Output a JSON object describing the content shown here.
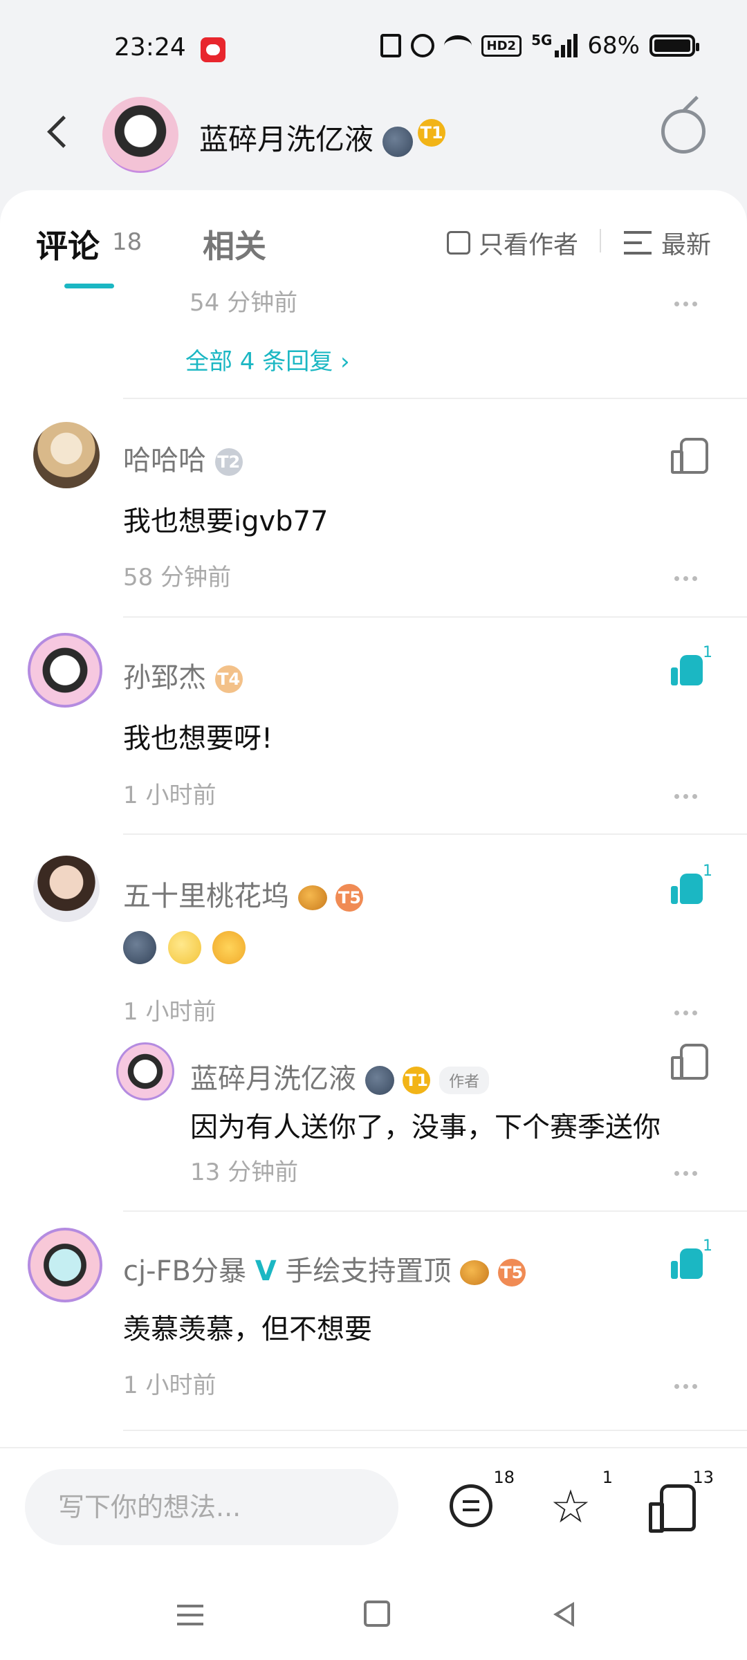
{
  "status_bar": {
    "time": "23:24",
    "network": "5G",
    "battery": "68%",
    "hd_label": "HD2"
  },
  "header": {
    "title": "蓝碎月洗亿液",
    "level_badge": "T1"
  },
  "tabs": {
    "comments_label": "评论",
    "comments_count": "18",
    "related_label": "相关",
    "only_author_label": "只看作者",
    "sort_label": "最新"
  },
  "top_partial": {
    "time": "54 分钟前",
    "replies_link": "全部 4 条回复"
  },
  "comments": [
    {
      "name": "哈哈哈",
      "level": "T2",
      "text": "我也想要igvb77",
      "time": "58 分钟前",
      "likes": ""
    },
    {
      "name": "孙郅杰",
      "level": "T4",
      "text": "我也想要呀!",
      "time": "1 小时前",
      "likes": "1"
    },
    {
      "name": "五十里桃花坞",
      "level": "T5",
      "text": "",
      "time": "1 小时前",
      "likes": "1"
    },
    {
      "name": "cj-FB分暴",
      "verified": "V",
      "name_suffix": "手绘支持置顶",
      "level": "T5",
      "text": "羡慕羡慕，但不想要",
      "time": "1 小时前",
      "likes": "1"
    }
  ],
  "reply": {
    "name": "蓝碎月洗亿液",
    "level": "T1",
    "author_tag": "作者",
    "text": "因为有人送你了，没事，下个赛季送你",
    "time": "13 分钟前"
  },
  "bottom_bar": {
    "input_placeholder": "写下你的想法...",
    "comment_count": "18",
    "star_count": "1",
    "like_count": "13"
  },
  "colors": {
    "accent": "#1bb7c3",
    "background": "#f2f3f5",
    "text": "#111111"
  }
}
